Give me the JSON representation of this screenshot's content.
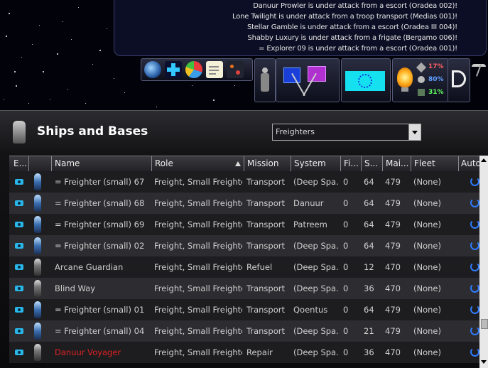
{
  "alerts": [
    "Danuur Prowler is under attack from a escort (Oradea 002)!",
    "Lone Twilight is under attack from a troop transport (Medias 001)!",
    "Stellar Gamble is under attack from a escort (Oradea III 004)!",
    "Shabby Luxury is under attack from a frigate (Bergamo 006)!",
    "= Explorer 09 is under attack from a escort (Oradea 001)!"
  ],
  "toolbar": {
    "icons": [
      "globe-icon",
      "plus-icon",
      "pie-chart-icon",
      "notepad-icon",
      "research-icon",
      "character-icon",
      "diplomacy-flags-icon",
      "empire-emblem-icon",
      "lightbulb-icon",
      "sword-icon",
      "production-icon",
      "approval-icon",
      "empire-flag-icon",
      "pickaxe-icon"
    ],
    "stats": {
      "research": "17%",
      "production": "80%",
      "approval": "31%"
    },
    "stat_colors": {
      "research": "#ff6060",
      "production": "#60a0ff",
      "approval": "#60ff60"
    }
  },
  "panel": {
    "title": "Ships and Bases",
    "filter_selected": "Freighters"
  },
  "table": {
    "headers": [
      "E...",
      "",
      "Name",
      "Role",
      "Mission",
      "System",
      "Fi...",
      "S...",
      "Mai...",
      "Fleet",
      "Auto..."
    ],
    "rows": [
      {
        "name": "= Freighter (small) 67",
        "role": "Freight, Small Freighter",
        "mission": "Transport",
        "system": "(Deep Spa...",
        "fi": "0",
        "s": "64",
        "mai": "479",
        "fleet": "(None)",
        "kind": "freighter",
        "highlight": false
      },
      {
        "name": "= Freighter (small) 68",
        "role": "Freight, Small Freighter",
        "mission": "Transport",
        "system": "Danuur",
        "fi": "0",
        "s": "64",
        "mai": "479",
        "fleet": "(None)",
        "kind": "freighter",
        "highlight": false
      },
      {
        "name": "= Freighter (small) 69",
        "role": "Freight, Small Freighter",
        "mission": "Transport",
        "system": "Patreem",
        "fi": "0",
        "s": "64",
        "mai": "479",
        "fleet": "(None)",
        "kind": "freighter",
        "highlight": false
      },
      {
        "name": "= Freighter (small) 02",
        "role": "Freight, Small Freighter",
        "mission": "Transport",
        "system": "(Deep Spa...",
        "fi": "0",
        "s": "64",
        "mai": "479",
        "fleet": "(None)",
        "kind": "freighter",
        "highlight": false
      },
      {
        "name": "Arcane Guardian",
        "role": "Freight, Small Freighter",
        "mission": "Refuel",
        "system": "(Deep Spa...",
        "fi": "0",
        "s": "12",
        "mai": "470",
        "fleet": "(None)",
        "kind": "alien",
        "highlight": false
      },
      {
        "name": "Blind Way",
        "role": "Freight, Small Freighter",
        "mission": "Transport",
        "system": "(Deep Spa...",
        "fi": "0",
        "s": "36",
        "mai": "470",
        "fleet": "(None)",
        "kind": "alien",
        "highlight": false
      },
      {
        "name": "= Freighter (small) 01",
        "role": "Freight, Small Freighter",
        "mission": "Transport",
        "system": "Qoentus",
        "fi": "0",
        "s": "64",
        "mai": "479",
        "fleet": "(None)",
        "kind": "freighter",
        "highlight": false
      },
      {
        "name": "= Freighter (small) 04",
        "role": "Freight, Small Freighter",
        "mission": "Transport",
        "system": "(Deep Spa...",
        "fi": "0",
        "s": "21",
        "mai": "479",
        "fleet": "(None)",
        "kind": "freighter",
        "highlight": false
      },
      {
        "name": "Danuur Voyager",
        "role": "Freight, Small Freighter",
        "mission": "Repair",
        "system": "(Deep Spa...",
        "fi": "0",
        "s": "36",
        "mai": "470",
        "fleet": "(None)",
        "kind": "alien",
        "highlight": true
      }
    ],
    "highlight_color": "#e02020"
  }
}
